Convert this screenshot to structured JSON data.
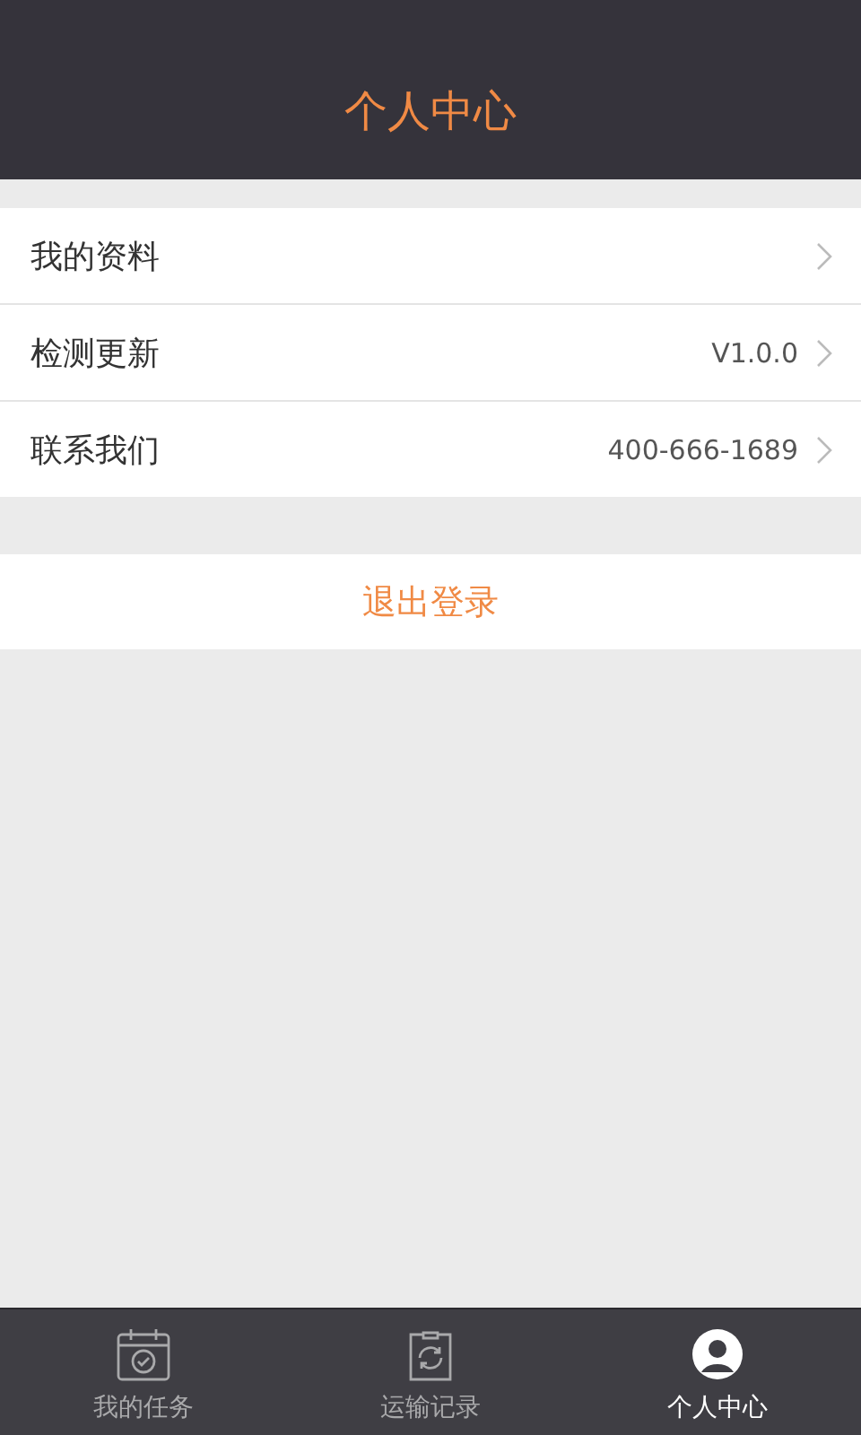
{
  "header": {
    "title": "个人中心"
  },
  "menu_items": [
    {
      "label": "我的资料"
    },
    {
      "label": "检测更新",
      "value": "V1.0.0"
    },
    {
      "label": "联系我们",
      "value": "400-666-1689"
    }
  ],
  "logout_button": {
    "label": "退出登录"
  },
  "tab_bar": [
    {
      "label": "我的任务",
      "kind": "tasks",
      "selected": false
    },
    {
      "label": "运输记录",
      "kind": "records",
      "selected": false
    },
    {
      "label": "个人中心",
      "kind": "profile",
      "selected": true
    }
  ]
}
